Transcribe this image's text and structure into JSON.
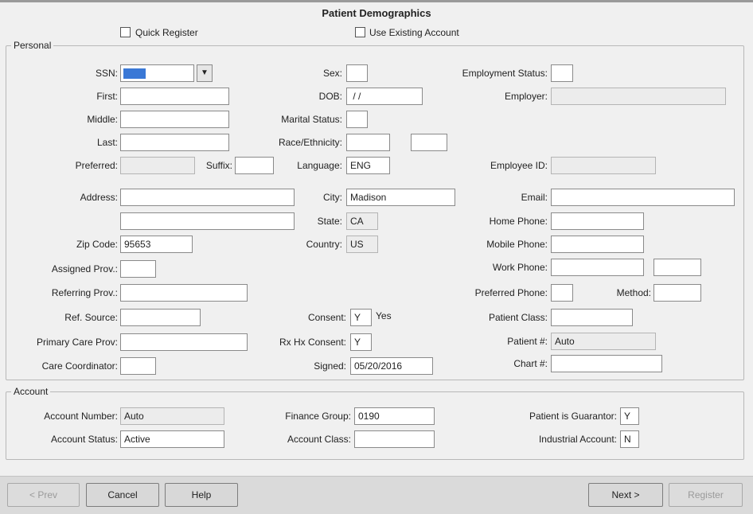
{
  "title": "Patient Demographics",
  "options": {
    "quick_register": "Quick Register",
    "use_existing": "Use Existing Account"
  },
  "personal": {
    "legend": "Personal",
    "ssn_label": "SSN:",
    "dropdown_arrow": "▼",
    "first_label": "First:",
    "middle_label": "Middle:",
    "last_label": "Last:",
    "preferred_label": "Preferred:",
    "suffix_label": "Suffix:",
    "sex_label": "Sex:",
    "dob_label": "DOB:",
    "dob_value": " / /",
    "marital_label": "Marital Status:",
    "race_label": "Race/Ethnicity:",
    "language_label": "Language:",
    "language_value": "ENG",
    "employment_label": "Employment Status:",
    "employer_label": "Employer:",
    "employee_id_label": "Employee ID:",
    "address_label": "Address:",
    "city_label": "City:",
    "city_value": "Madison",
    "state_label": "State:",
    "state_value": "CA",
    "zip_label": "Zip Code:",
    "zip_value": "95653",
    "country_label": "Country:",
    "country_value": "US",
    "email_label": "Email:",
    "home_phone_label": "Home Phone:",
    "mobile_phone_label": "Mobile Phone:",
    "work_phone_label": "Work Phone:",
    "preferred_phone_label": "Preferred Phone:",
    "method_label": "Method:",
    "assigned_prov_label": "Assigned Prov.:",
    "referring_prov_label": "Referring Prov.:",
    "ref_source_label": "Ref. Source:",
    "primary_care_label": "Primary Care Prov:",
    "care_coord_label": "Care Coordinator:",
    "consent_label": "Consent:",
    "consent_value": "Y",
    "consent_text": "Yes",
    "rx_consent_label": "Rx Hx Consent:",
    "rx_consent_value": "Y",
    "signed_label": "Signed:",
    "signed_value": "05/20/2016",
    "patient_class_label": "Patient Class:",
    "patient_num_label": "Patient #:",
    "patient_num_value": "Auto",
    "chart_label": "Chart #:"
  },
  "account": {
    "legend": "Account",
    "number_label": "Account Number:",
    "number_value": "Auto",
    "status_label": "Account Status:",
    "status_value": "Active",
    "finance_label": "Finance Group:",
    "finance_value": "0190",
    "class_label": "Account Class:",
    "guarantor_label": "Patient is Guarantor:",
    "guarantor_value": "Y",
    "industrial_label": "Industrial Account:",
    "industrial_value": "N"
  },
  "buttons": {
    "prev": "< Prev",
    "cancel": "Cancel",
    "help": "Help",
    "next": "Next >",
    "register": "Register"
  }
}
